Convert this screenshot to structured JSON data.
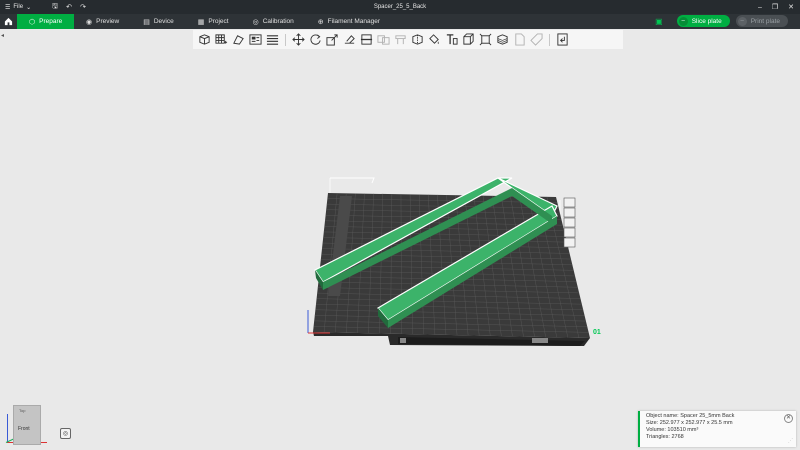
{
  "titlebar": {
    "file_label": "File",
    "document_title": "Spacer_25_5_Back"
  },
  "tabs": [
    {
      "label": "Prepare",
      "icon": "cube-icon",
      "active": true
    },
    {
      "label": "Preview",
      "icon": "eye-icon",
      "active": false
    },
    {
      "label": "Device",
      "icon": "printer-icon",
      "active": false
    },
    {
      "label": "Project",
      "icon": "grid-icon",
      "active": false
    },
    {
      "label": "Calibration",
      "icon": "target-icon",
      "active": false
    },
    {
      "label": "Filament Manager",
      "icon": "globe-icon",
      "active": false
    }
  ],
  "actions": {
    "slice_label": "Slice plate",
    "print_label": "Print plate"
  },
  "viewcube": {
    "top_label": "Top",
    "front_label": "Front"
  },
  "bed": {
    "plate_number": "01"
  },
  "object_info": {
    "name_line": "Object name: Spacer 25_5mm Back",
    "size_line": "Size: 252.977 x 252.977 x 25.5 mm",
    "volume_line": "Volume: 103510 mm³",
    "triangles_line": "Triangles: 2768"
  },
  "colors": {
    "accent": "#00ae42",
    "model": "#2f8f52",
    "bed": "#3a3a3a"
  }
}
